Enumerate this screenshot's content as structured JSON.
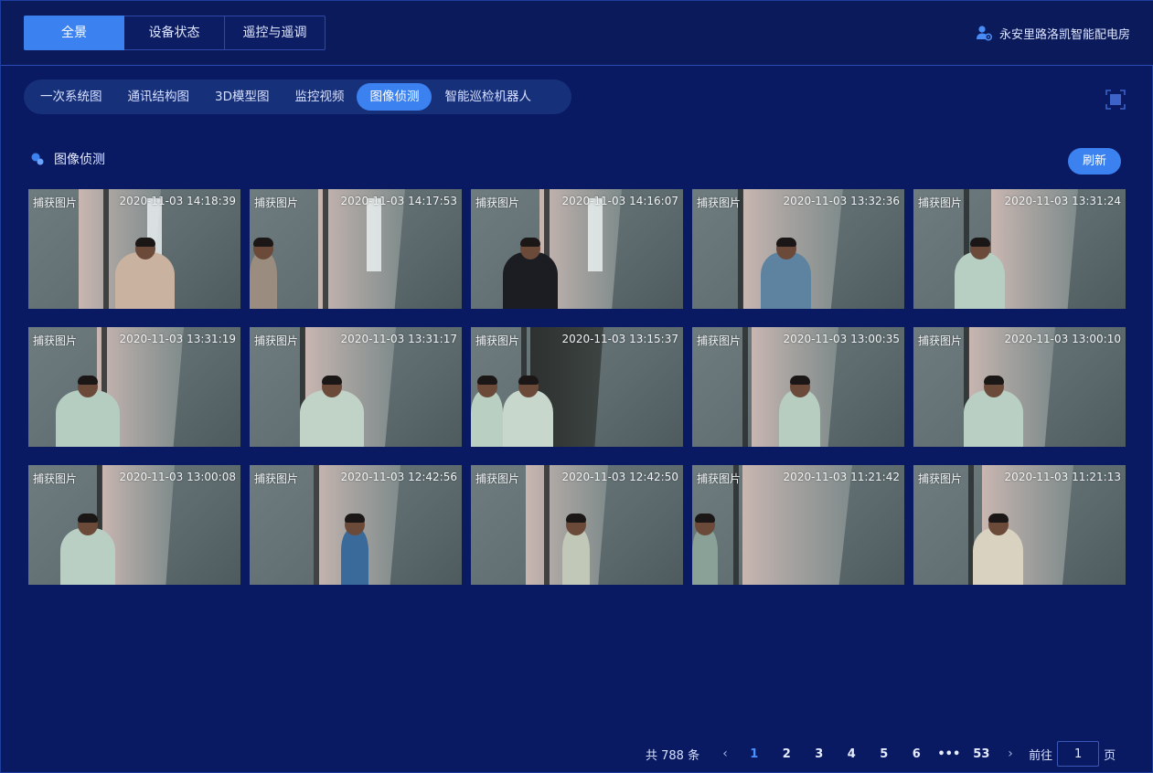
{
  "header": {
    "top_tabs": [
      {
        "label": "全景",
        "active": true
      },
      {
        "label": "设备状态",
        "active": false
      },
      {
        "label": "遥控与遥调",
        "active": false
      }
    ],
    "station_name": "永安里路洛凯智能配电房",
    "station_icon": "user-gear-icon"
  },
  "sub_tabs": [
    {
      "label": "一次系统图",
      "active": false
    },
    {
      "label": "通讯结构图",
      "active": false
    },
    {
      "label": "3D模型图",
      "active": false
    },
    {
      "label": "监控视频",
      "active": false
    },
    {
      "label": "图像侦测",
      "active": true
    },
    {
      "label": "智能巡检机器人",
      "active": false
    }
  ],
  "section": {
    "title": "图像侦测",
    "refresh_label": "刷新"
  },
  "captures": [
    {
      "label": "捕获图片",
      "time": "2020-11-03 14:18:39"
    },
    {
      "label": "捕获图片",
      "time": "2020-11-03 14:17:53"
    },
    {
      "label": "捕获图片",
      "time": "2020-11-03 14:16:07"
    },
    {
      "label": "捕获图片",
      "time": "2020-11-03 13:32:36"
    },
    {
      "label": "捕获图片",
      "time": "2020-11-03 13:31:24"
    },
    {
      "label": "捕获图片",
      "time": "2020-11-03 13:31:19"
    },
    {
      "label": "捕获图片",
      "time": "2020-11-03 13:31:17"
    },
    {
      "label": "捕获图片",
      "time": "2020-11-03 13:15:37"
    },
    {
      "label": "捕获图片",
      "time": "2020-11-03 13:00:35"
    },
    {
      "label": "捕获图片",
      "time": "2020-11-03 13:00:10"
    },
    {
      "label": "捕获图片",
      "time": "2020-11-03 13:00:08"
    },
    {
      "label": "捕获图片",
      "time": "2020-11-03 12:42:56"
    },
    {
      "label": "捕获图片",
      "time": "2020-11-03 12:42:50"
    },
    {
      "label": "捕获图片",
      "time": "2020-11-03 11:21:42"
    },
    {
      "label": "捕获图片",
      "time": "2020-11-03 11:21:13"
    }
  ],
  "pagination": {
    "total_text": "共 788 条",
    "pages": [
      "1",
      "2",
      "3",
      "4",
      "5",
      "6",
      "•••",
      "53"
    ],
    "current": "1",
    "goto_label": "前往",
    "goto_value": "1",
    "page_suffix": "页"
  },
  "colors": {
    "accent": "#3b82f0",
    "background": "#0a1a62",
    "active_page": "#4a90ff"
  }
}
